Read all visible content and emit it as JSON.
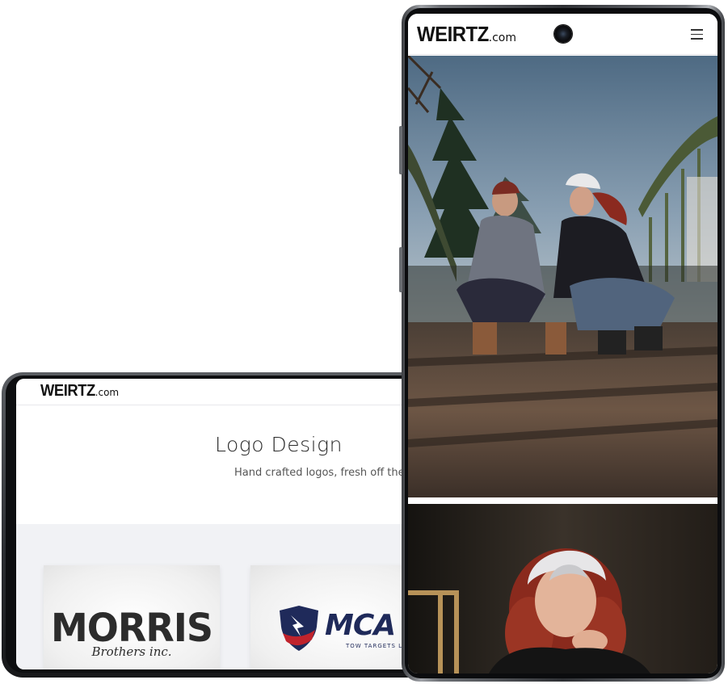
{
  "landscape_device": {
    "site": {
      "logo_word": "WEIRTZ",
      "logo_suffix": ".com"
    },
    "hero": {
      "title": "Logo Design",
      "subtitle": "Hand crafted logos, fresh off the a"
    },
    "logos": [
      {
        "title": "MORRIS",
        "subtitle": "Brothers inc."
      },
      {
        "title": "MCA",
        "subtitle": "TOW TARGETS LLC"
      }
    ]
  },
  "portrait_device": {
    "site": {
      "logo_word": "WEIRTZ",
      "logo_suffix": ".com"
    },
    "header": {
      "menu_icon": "hamburger-icon",
      "camera": "front-camera"
    },
    "photos": [
      {
        "description": "two-people-crouching-on-bridge"
      },
      {
        "description": "portrait-red-hair-white-cap"
      }
    ]
  },
  "colors": {
    "navy": "#1f2a5a",
    "red": "#c0232c",
    "gallery_bg": "#f1f2f5"
  }
}
